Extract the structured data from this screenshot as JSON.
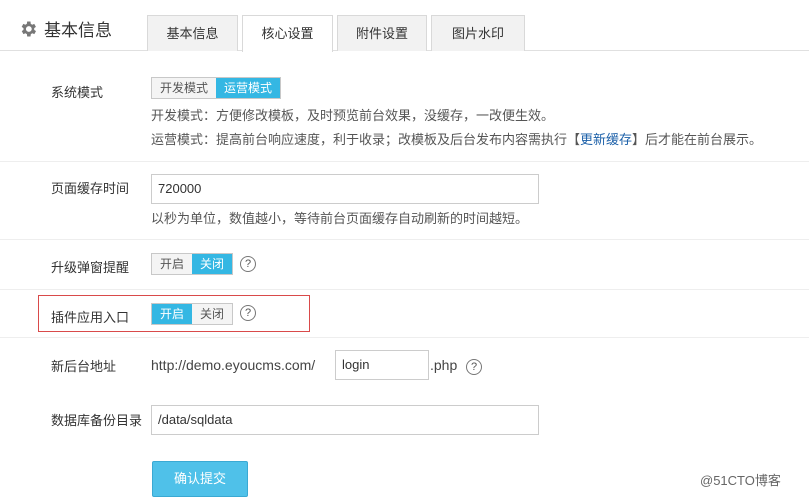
{
  "header": {
    "title": "基本信息",
    "icon": "gear-icon",
    "tabs": [
      {
        "label": "基本信息",
        "active": false
      },
      {
        "label": "核心设置",
        "active": true
      },
      {
        "label": "附件设置",
        "active": false
      },
      {
        "label": "图片水印",
        "active": false
      }
    ]
  },
  "system_mode": {
    "label": "系统模式",
    "options": [
      "开发模式",
      "运营模式"
    ],
    "selected": "运营模式",
    "desc_dev": "开发模式：方便修改模板，及时预览前台效果，没缓存，一改便生效。",
    "desc_ops_pre": "运营模式：提高前台响应速度，利于收录；改模板及后台发布内容需执行【",
    "desc_ops_link": "更新缓存",
    "desc_ops_post": "】后才能在前台展示。"
  },
  "page_cache": {
    "label": "页面缓存时间",
    "value": "720000",
    "desc": "以秒为单位，数值越小，等待前台页面缓存自动刷新的时间越短。"
  },
  "upgrade_popup": {
    "label": "升级弹窗提醒",
    "options": [
      "开启",
      "关闭"
    ],
    "selected": "关闭"
  },
  "plugin_entry": {
    "label": "插件应用入口",
    "options": [
      "开启",
      "关闭"
    ],
    "selected": "开启"
  },
  "admin_url": {
    "label": "新后台地址",
    "prefix": "http://demo.eyoucms.com/",
    "value": "login",
    "suffix": ".php"
  },
  "backup_dir": {
    "label": "数据库备份目录",
    "value": "/data/sqldata"
  },
  "submit_label": "确认提交",
  "watermark": "@51CTO博客",
  "colors": {
    "accent": "#34b7e3",
    "highlight": "#d94a4a",
    "button": "#4fc1e9"
  }
}
